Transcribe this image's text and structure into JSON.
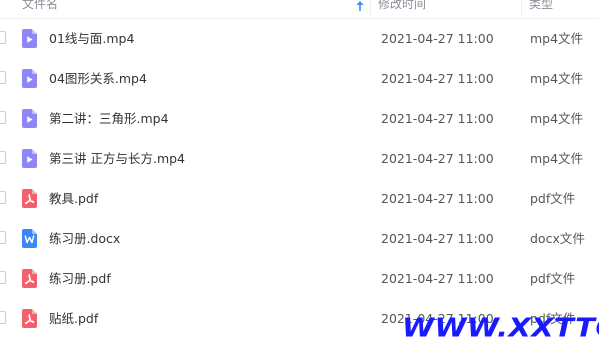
{
  "columns": {
    "name": "文件名",
    "modified": "修改时间",
    "type": "类型"
  },
  "sort": {
    "column": "name",
    "icon": "sort-arrow-up-icon"
  },
  "files": [
    {
      "name": "01线与面.mp4",
      "modified": "2021-04-27 11:00",
      "type": "mp4文件",
      "icon": "video-file-icon"
    },
    {
      "name": "04图形关系.mp4",
      "modified": "2021-04-27 11:00",
      "type": "mp4文件",
      "icon": "video-file-icon"
    },
    {
      "name": "第二讲：三角形.mp4",
      "modified": "2021-04-27 11:00",
      "type": "mp4文件",
      "icon": "video-file-icon"
    },
    {
      "name": "第三讲 正方与长方.mp4",
      "modified": "2021-04-27 11:00",
      "type": "mp4文件",
      "icon": "video-file-icon"
    },
    {
      "name": "教具.pdf",
      "modified": "2021-04-27 11:00",
      "type": "pdf文件",
      "icon": "pdf-file-icon"
    },
    {
      "name": "练习册.docx",
      "modified": "2021-04-27 11:00",
      "type": "docx文件",
      "icon": "word-file-icon"
    },
    {
      "name": "练习册.pdf",
      "modified": "2021-04-27 11:00",
      "type": "pdf文件",
      "icon": "pdf-file-icon"
    },
    {
      "name": "贴纸.pdf",
      "modified": "2021-04-27 11:00",
      "type": "pdf文件",
      "icon": "pdf-file-icon"
    }
  ],
  "colors": {
    "video": "#8f87f4",
    "pdf": "#f2616b",
    "word": "#3d86f5",
    "sort_accent": "#3b8cf0",
    "watermark": "#1a1aff"
  },
  "watermark": "WWW.XXTTQ.COM"
}
